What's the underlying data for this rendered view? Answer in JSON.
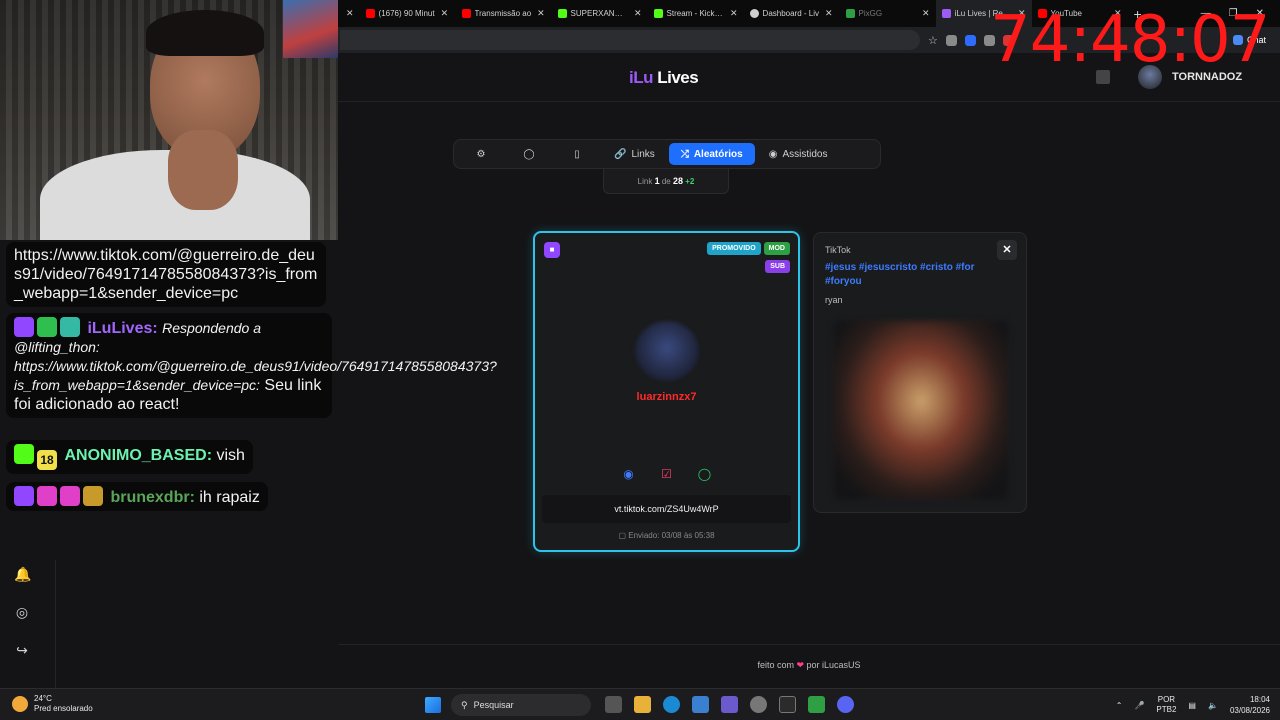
{
  "browser": {
    "tabs": [
      {
        "title": "",
        "color": "#444444",
        "active": false
      },
      {
        "title": "(1676) 90 Minut",
        "color": "#ff0000",
        "active": false
      },
      {
        "title": "Transmissão ao",
        "color": "#ff0000",
        "active": false
      },
      {
        "title": "SUPERXANDAO",
        "color": "#53fc18",
        "active": false
      },
      {
        "title": "Stream - Kick Da",
        "color": "#53fc18",
        "active": false
      },
      {
        "title": "Dashboard - Liv",
        "color": "#cfcfcf",
        "active": false
      },
      {
        "title": "PixGG",
        "color": "#2ea043",
        "active": false
      },
      {
        "title": "iLu Lives | React",
        "color": "#9b5cf6",
        "active": true
      },
      {
        "title": "YouTube",
        "color": "#ff0000",
        "active": false
      }
    ],
    "chat_label": "Chat"
  },
  "overlay": {
    "timer": "74:48:07"
  },
  "site": {
    "logo_prefix": "iLu",
    "logo_suffix": " Lives",
    "username": "TORNNADOZ"
  },
  "chat": {
    "m1_text": "https://www.tiktok.com/@guerreiro.de_deus91/video/7649171478558084373?is_from_webapp=1&sender_device=pc",
    "m2_user": "iLuLives:",
    "m2_italic": "Respondendo a @lifting_thon: https://www.tiktok.com/@guerreiro.de_deus91/video/7649171478558084373?is_from_webapp=1&sender_device=pc:",
    "m2_text": "Seu link foi adicionado ao react!",
    "m3_badge": "18",
    "m3_user": "ANONIMO_BASED:",
    "m3_text": "vish",
    "m4_user": "brunexdbr:",
    "m4_text": "ih rapaiz"
  },
  "nav": {
    "links_label": "Links",
    "random_label": "Aleatórios",
    "watched_label": "Assistidos"
  },
  "counter": {
    "prefix": "Link",
    "current": "1",
    "of": "de",
    "total": "28",
    "extra": "+2"
  },
  "card": {
    "tag_promoted": "PROMOVIDO",
    "tag_mod": "MOD",
    "tag_sub": "SUB",
    "username": "luarzinnzx7",
    "link": "vt.tiktok.com/ZS4Uw4WrP",
    "sent": "Enviado: 03/08 às 05:38"
  },
  "preview": {
    "platform": "TikTok",
    "hashtags": "#jesus #jesuscristo #cristo #for #foryou",
    "author": "ryan",
    "close_label": "✕"
  },
  "footer": {
    "prefix": "feito com",
    "suffix": "por iLucasUS"
  },
  "taskbar": {
    "temp": "24°C",
    "weather": "Pred ensolarado",
    "search_placeholder": "Pesquisar",
    "lang_top": "POR",
    "lang_bottom": "PTB2",
    "time": "18:04",
    "date": "03/08/2026"
  }
}
